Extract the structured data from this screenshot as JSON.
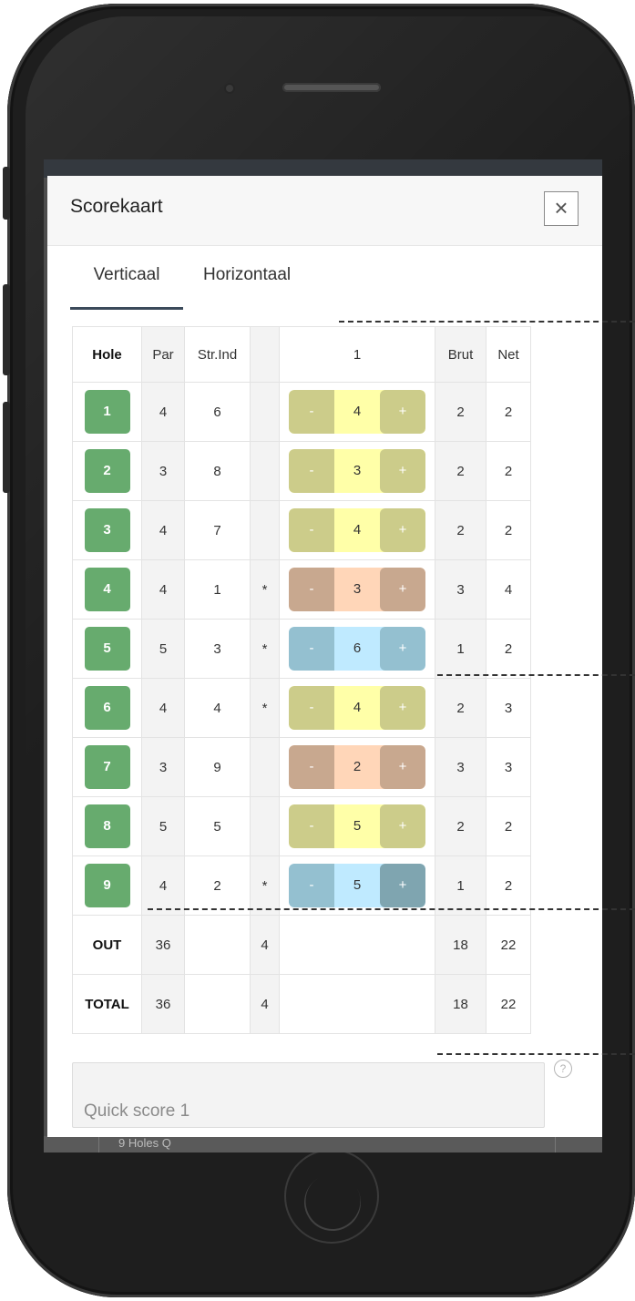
{
  "modal": {
    "title": "Scorekaart",
    "close_icon": "close-icon"
  },
  "tabs": [
    {
      "label": "Verticaal",
      "active": true
    },
    {
      "label": "Horizontaal",
      "active": false
    }
  ],
  "table": {
    "headers": {
      "hole": "Hole",
      "par": "Par",
      "stroke_index": "Str.Ind",
      "star": "",
      "player": "1",
      "brut": "Brut",
      "net": "Net"
    },
    "rows": [
      {
        "hole": "1",
        "par": "4",
        "si": "6",
        "star": "",
        "minus": "-",
        "score": "4",
        "plus": "+",
        "brut": "2",
        "net": "2",
        "theme": "par"
      },
      {
        "hole": "2",
        "par": "3",
        "si": "8",
        "star": "",
        "minus": "-",
        "score": "3",
        "plus": "+",
        "brut": "2",
        "net": "2",
        "theme": "par"
      },
      {
        "hole": "3",
        "par": "4",
        "si": "7",
        "star": "",
        "minus": "-",
        "score": "4",
        "plus": "+",
        "brut": "2",
        "net": "2",
        "theme": "par"
      },
      {
        "hole": "4",
        "par": "4",
        "si": "1",
        "star": "*",
        "minus": "-",
        "score": "3",
        "plus": "+",
        "brut": "3",
        "net": "4",
        "theme": "under"
      },
      {
        "hole": "5",
        "par": "5",
        "si": "3",
        "star": "*",
        "minus": "-",
        "score": "6",
        "plus": "+",
        "brut": "1",
        "net": "2",
        "theme": "over"
      },
      {
        "hole": "6",
        "par": "4",
        "si": "4",
        "star": "*",
        "minus": "-",
        "score": "4",
        "plus": "+",
        "brut": "2",
        "net": "3",
        "theme": "par"
      },
      {
        "hole": "7",
        "par": "3",
        "si": "9",
        "star": "",
        "minus": "-",
        "score": "2",
        "plus": "+",
        "brut": "3",
        "net": "3",
        "theme": "under"
      },
      {
        "hole": "8",
        "par": "5",
        "si": "5",
        "star": "",
        "minus": "-",
        "score": "5",
        "plus": "+",
        "brut": "2",
        "net": "2",
        "theme": "par"
      },
      {
        "hole": "9",
        "par": "4",
        "si": "2",
        "star": "*",
        "minus": "-",
        "score": "5",
        "plus": "+",
        "brut": "1",
        "net": "2",
        "theme": "over-active"
      }
    ],
    "totals": [
      {
        "label": "OUT",
        "par": "36",
        "star": "4",
        "brut": "18",
        "net": "22"
      },
      {
        "label": "TOTAL",
        "par": "36",
        "star": "4",
        "brut": "18",
        "net": "22"
      }
    ]
  },
  "quick_score": {
    "placeholder": "Quick score 1",
    "help_icon": "question-circle-icon",
    "help_glyph": "?"
  },
  "background": {
    "partial_text": "9 Holes Q"
  },
  "colors": {
    "hole_green": "#67ab6e",
    "par_btn": "#cccc8a",
    "par_bg": "#ffffa8",
    "under_btn": "#c8a88f",
    "under_bg": "#ffd6b8",
    "over_btn": "#94c0d0",
    "over_bg": "#bfeaff",
    "over_active_btn": "#7fa5b0"
  }
}
